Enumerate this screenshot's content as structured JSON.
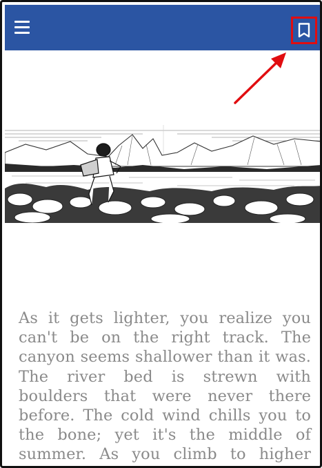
{
  "app_bar": {
    "color": "#2b55a3",
    "menu_icon": "hamburger-menu-icon",
    "bookmark_icon": "bookmark-icon",
    "highlight_color": "#e10d10"
  },
  "illustration": {
    "description_icon": "boy-climbing-rocks-mountains-illustration"
  },
  "story": {
    "text": "As it gets lighter, you realize you can't be on the right track. The canyon seems shallower than it was. The river bed is strewn with boulders that were never there before. The cold wind chills you to the bone; yet it's the middle of summer. As you climb to higher ground to get a better view, you"
  }
}
